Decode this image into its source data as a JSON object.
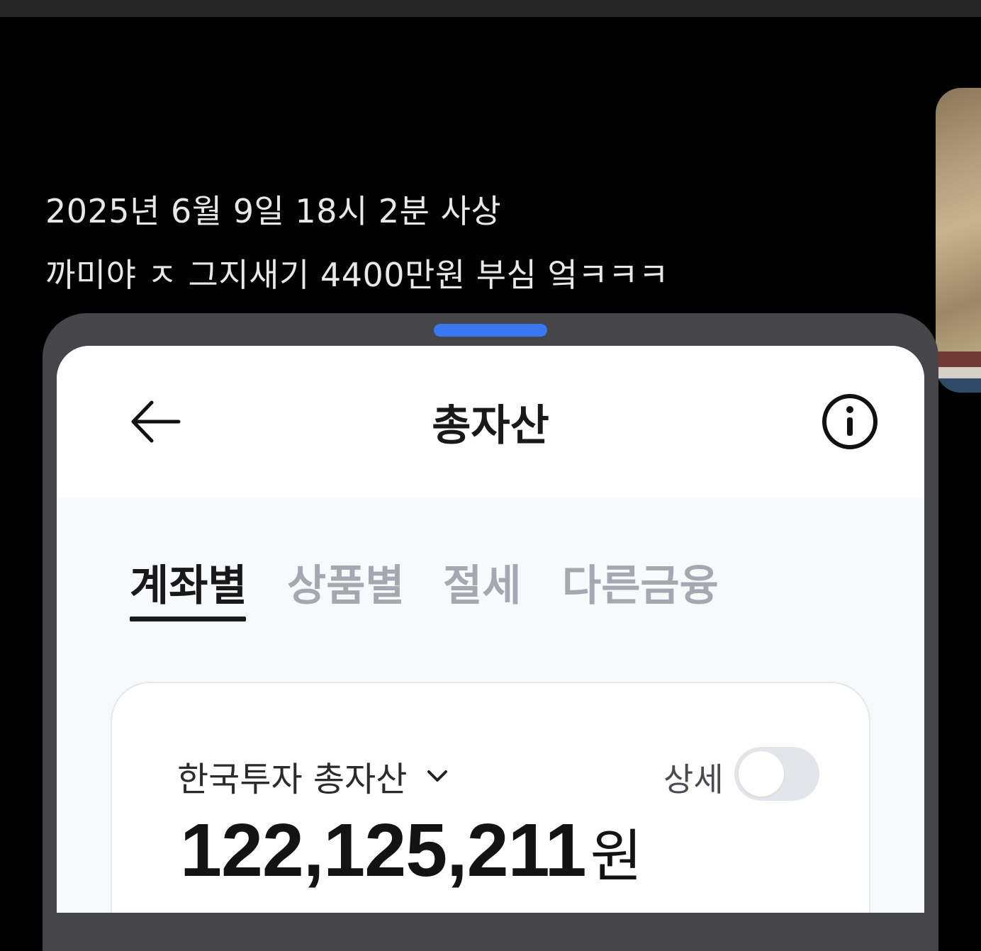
{
  "caption": {
    "line1": "2025년 6월 9일 18시 2분 사상",
    "line2": "까미야 ㅈ 그지새기 4400만원 부심 엌ㅋㅋㅋ"
  },
  "app": {
    "title": "총자산",
    "back_icon": "arrow-left-icon",
    "info_icon": "info-circle-icon"
  },
  "tabs": [
    {
      "label": "계좌별",
      "active": true
    },
    {
      "label": "상품별",
      "active": false
    },
    {
      "label": "절세",
      "active": false
    },
    {
      "label": "다른금융",
      "active": false
    }
  ],
  "summary": {
    "account_label": "한국투자 총자산",
    "detail_label": "상세",
    "detail_toggle_on": false,
    "amount": "122,125,211",
    "unit": "원"
  },
  "colors": {
    "accent_handle": "#3a78f2",
    "active_tab": "#191919",
    "inactive_tab": "#a5a8b1"
  }
}
